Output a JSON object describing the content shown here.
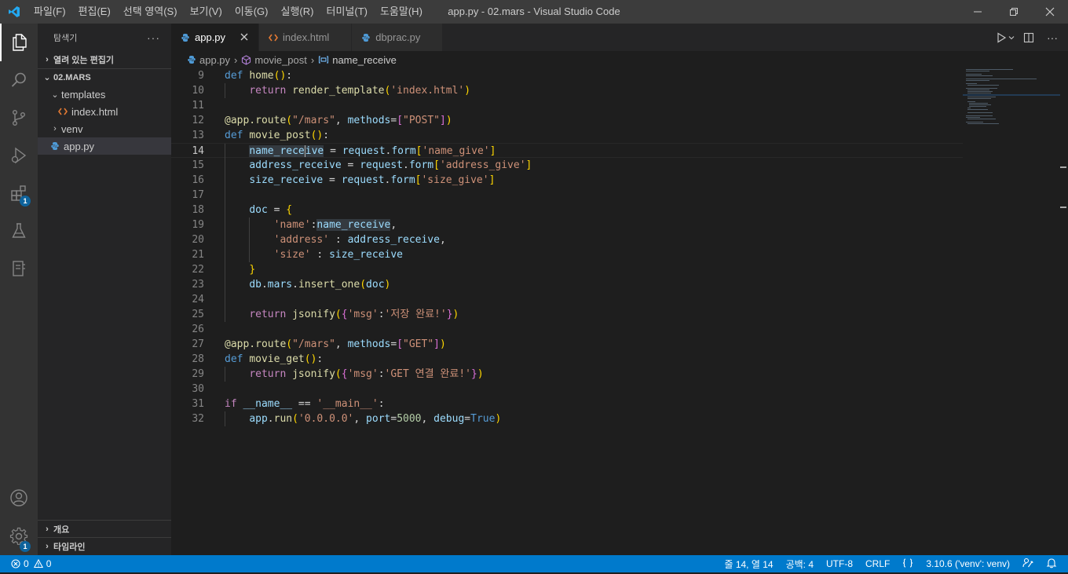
{
  "window": {
    "title": "app.py - 02.mars - Visual Studio Code"
  },
  "menu": [
    "파일(F)",
    "편집(E)",
    "선택 영역(S)",
    "보기(V)",
    "이동(G)",
    "실행(R)",
    "터미널(T)",
    "도움말(H)"
  ],
  "activity": {
    "extensions_badge": "1",
    "settings_badge": "1"
  },
  "sidebar": {
    "title": "탐색기",
    "more": "···",
    "open_editors": "열려 있는 편집기",
    "folder": "02.MARS",
    "tree": [
      {
        "label": "templates",
        "type": "folder-open",
        "depth": 1
      },
      {
        "label": "index.html",
        "type": "html",
        "depth": 2
      },
      {
        "label": "venv",
        "type": "folder",
        "depth": 1
      },
      {
        "label": "app.py",
        "type": "python",
        "depth": 1,
        "selected": true
      }
    ],
    "outline": "개요",
    "timeline": "타임라인"
  },
  "tabs": [
    {
      "label": "app.py",
      "type": "python",
      "active": true
    },
    {
      "label": "index.html",
      "type": "html",
      "active": false
    },
    {
      "label": "dbprac.py",
      "type": "python",
      "active": false
    }
  ],
  "breadcrumb": {
    "file": "app.py",
    "func": "movie_post",
    "var": "name_receive"
  },
  "code": {
    "current_line": 14,
    "lines": [
      {
        "n": "9"
      },
      {
        "n": "10"
      },
      {
        "n": "11"
      },
      {
        "n": "12"
      },
      {
        "n": "13"
      },
      {
        "n": "14"
      },
      {
        "n": "15"
      },
      {
        "n": "16"
      },
      {
        "n": "17"
      },
      {
        "n": "18"
      },
      {
        "n": "19"
      },
      {
        "n": "20"
      },
      {
        "n": "21"
      },
      {
        "n": "22"
      },
      {
        "n": "23"
      },
      {
        "n": "24"
      },
      {
        "n": "25"
      },
      {
        "n": "26"
      },
      {
        "n": "27"
      },
      {
        "n": "28"
      },
      {
        "n": "29"
      },
      {
        "n": "30"
      },
      {
        "n": "31"
      },
      {
        "n": "32"
      }
    ]
  },
  "status": {
    "errors": "0",
    "warnings": "0",
    "position": "줄 14, 열 14",
    "spaces": "공백: 4",
    "encoding": "UTF-8",
    "eol": "CRLF",
    "interpreter": "3.10.6 ('venv': venv)"
  },
  "colors": {
    "accent": "#007acc",
    "titlebar": "#3c3c3c",
    "activitybar": "#333333",
    "sidebar": "#252526",
    "editor": "#1e1e1e"
  }
}
